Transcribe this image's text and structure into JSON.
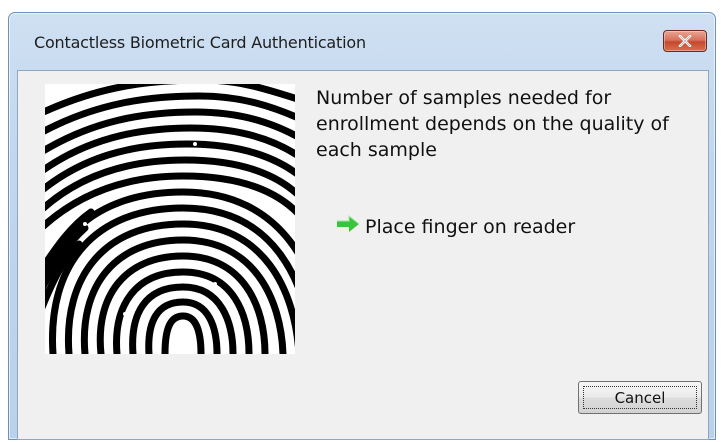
{
  "window": {
    "title": "Contactless Biometric Card Authentication"
  },
  "titlebar": {
    "close_icon": "close-icon",
    "close_color": "#c6482f"
  },
  "main": {
    "fingerprint_image": "fingerprint-image",
    "info_text": "Number of samples needed for enrollment depends on the quality of each sample",
    "prompt_icon": "arrow-right-icon",
    "prompt_icon_color": "#3cc23c",
    "prompt_text": "Place finger on reader"
  },
  "footer": {
    "cancel_label": "Cancel"
  }
}
